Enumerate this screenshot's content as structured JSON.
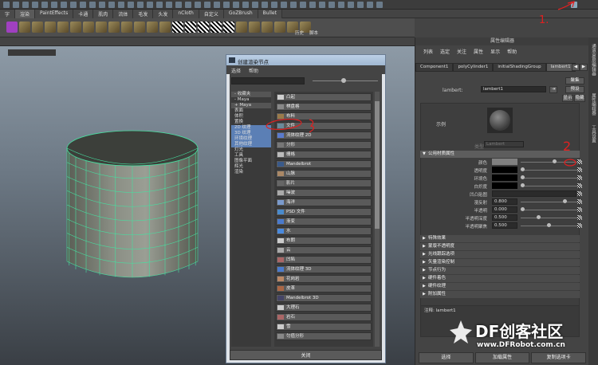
{
  "shelf_tabs": [
    "字",
    "渲染",
    "PaintEffects",
    "卡通",
    "肌肉",
    "流体",
    "毛发",
    "头发",
    "nCloth",
    "自定义",
    "GoZBrush",
    "Bullet"
  ],
  "shelf_icon_labels": [
    "历史",
    "脚本"
  ],
  "dialog": {
    "title": "创建渲染节点",
    "menu": [
      "选择",
      "帮助"
    ],
    "tree": [
      {
        "label": "- 收藏夹",
        "sel": false,
        "hdr": true
      },
      {
        "label": "- Maya",
        "sel": false,
        "hdr": false
      },
      {
        "label": "+ Maya",
        "sel": false,
        "hdr": true
      },
      {
        "label": "表面",
        "sel": false,
        "hdr": false
      },
      {
        "label": "体积",
        "sel": false,
        "hdr": false
      },
      {
        "label": "置换",
        "sel": false,
        "hdr": false
      },
      {
        "label": "2D 纹理",
        "sel": true,
        "hdr": false
      },
      {
        "label": "3D 纹理",
        "sel": true,
        "hdr": false
      },
      {
        "label": "环境纹理",
        "sel": true,
        "hdr": false
      },
      {
        "label": "其他纹理",
        "sel": true,
        "hdr": false
      },
      {
        "label": "灯光",
        "sel": false,
        "hdr": false
      },
      {
        "label": "工具",
        "sel": false,
        "hdr": false
      },
      {
        "label": "图像平面",
        "sel": false,
        "hdr": false
      },
      {
        "label": "辉光",
        "sel": false,
        "hdr": false
      },
      {
        "label": "渲染",
        "sel": false,
        "hdr": false
      }
    ],
    "nodes": [
      "凸起",
      "棋盘格",
      "布料",
      "文件",
      "流体纹理 2D",
      "分形",
      "栅格",
      "Mandelbrot",
      "山脉",
      "影片",
      "噪波",
      "海洋",
      "PSD 文件",
      "渐变",
      "水",
      "布朗",
      "云",
      "凹陷",
      "流体纹理 3D",
      "花岗岩",
      "皮革",
      "Mandelbrot 3D",
      "大理石",
      "岩石",
      "雪",
      "匀值分形"
    ],
    "node_colors": [
      "#cfcfcf",
      "#888888",
      "#9a7a4a",
      "#6a8a9a",
      "#5a7acc",
      "#777777",
      "#bbbbbb",
      "#3a5a8a",
      "#aa8866",
      "#666666",
      "#aaaaaa",
      "#7a9acc",
      "#4a8acc",
      "#4a7acc",
      "#4a8ade",
      "#cccccc",
      "#aaaaaa",
      "#aa6666",
      "#4a7acc",
      "#bb8866",
      "#aa6644",
      "#444466",
      "#cccccc",
      "#aa6666",
      "#cccccc",
      "#888888"
    ],
    "close_label": "关闭"
  },
  "ae": {
    "title": "属性编辑器",
    "menu": [
      "列表",
      "选定",
      "关注",
      "属性",
      "显示",
      "帮助"
    ],
    "tabs": [
      "Component1",
      "polyCylinder1",
      "initialShadingGroup",
      "lambert1"
    ],
    "name_label": "lambert:",
    "name_value": "lambert1",
    "buttons": [
      "聚集",
      "预设",
      "显示",
      "隐藏"
    ],
    "sample_label": "示例",
    "type_label": "类型",
    "type_value": "Lambert",
    "section_common": "公用材质属性",
    "attrs": [
      {
        "label": "颜色",
        "kind": "swatch",
        "color": "#808080",
        "value": "",
        "slider": 0.6
      },
      {
        "label": "透明度",
        "kind": "swatch",
        "color": "#000000",
        "value": "",
        "slider": 0
      },
      {
        "label": "环境色",
        "kind": "swatch",
        "color": "#000000",
        "value": "",
        "slider": 0
      },
      {
        "label": "白炽度",
        "kind": "swatch",
        "color": "#000000",
        "value": "",
        "slider": 0
      },
      {
        "label": "凹凸贴图",
        "kind": "empty",
        "color": "",
        "value": "",
        "slider": -1
      },
      {
        "label": "漫反射",
        "kind": "num",
        "color": "",
        "value": "0.800",
        "slider": 0.8
      },
      {
        "label": "半透明",
        "kind": "num",
        "color": "",
        "value": "0.000",
        "slider": 0
      },
      {
        "label": "半透明深度",
        "kind": "num",
        "color": "",
        "value": "0.500",
        "slider": 0.3
      },
      {
        "label": "半透明聚焦",
        "kind": "num",
        "color": "",
        "value": "0.500",
        "slider": 0.5
      }
    ],
    "sections": [
      "特殊效果",
      "蒙版不透明度",
      "光线跟踪选项",
      "矢量渲染控制",
      "节点行为",
      "硬件着色",
      "硬件纹理",
      "附加属性"
    ],
    "notes_label": "注释: lambert1",
    "bottom_buttons": [
      "选择",
      "加载属性",
      "复制选项卡"
    ]
  },
  "right_strip": [
    "通道盒/层编辑器",
    "属性编辑器",
    "工具设置"
  ],
  "annotations": [
    "1.",
    "2"
  ],
  "watermark": {
    "title": "DF创客社区",
    "url": "www.DFRobot.com.cn"
  }
}
